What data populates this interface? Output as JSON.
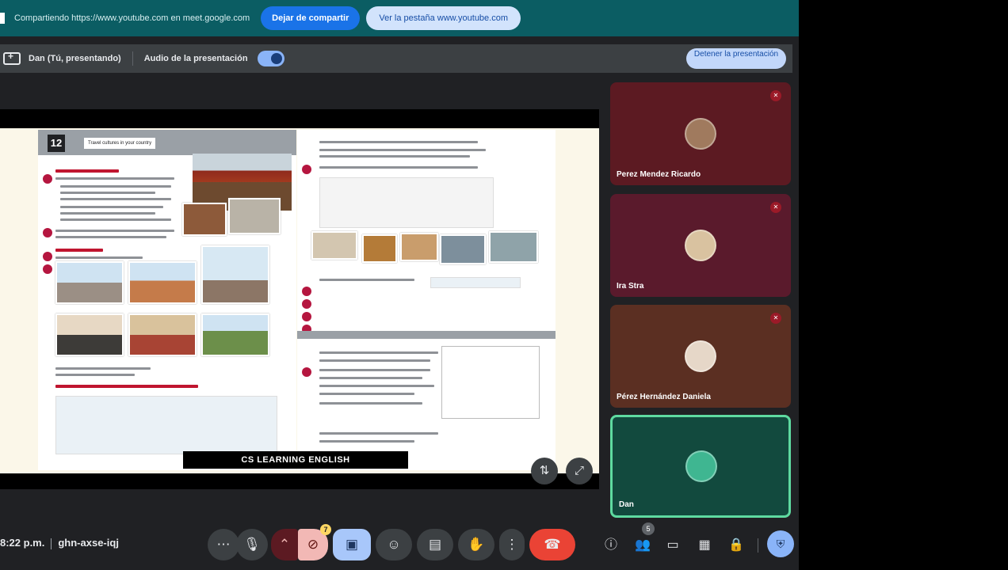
{
  "share_banner": {
    "text": "Compartiendo https://www.youtube.com en meet.google.com",
    "stop_sharing_label": "Dejar de compartir",
    "view_tab_label": "Ver la pestaña www.youtube.com"
  },
  "presenting_bar": {
    "presenter": "Dan (Tú, presentando)",
    "audio_label": "Audio de la presentación",
    "audio_enabled": true,
    "stop_presenting_label": "Detener la presentación"
  },
  "slide": {
    "unit_number": "12",
    "unit_title": "Travel cultures in your country",
    "caption": "CS LEARNING ENGLISH",
    "tools": [
      "pin-icon",
      "fullscreen-icon"
    ]
  },
  "participants": [
    {
      "name": "Perez Mendez Ricardo",
      "muted": true,
      "color": "#5c1a22"
    },
    {
      "name": "Ira Stra",
      "muted": true,
      "color": "#5a1a2c"
    },
    {
      "name": "Pérez Hernández Daniela",
      "muted": true,
      "color": "#5b2f22"
    },
    {
      "name": "Dan",
      "muted": false,
      "color": "#124a3e"
    }
  ],
  "bottom_bar": {
    "time": "8:22 p.m.",
    "meeting_code": "ghn-axse-iqj",
    "chat_badge": "7",
    "people_count": "5",
    "controls": [
      "more-options-icon",
      "mic-icon",
      "camera-chevron-icon",
      "camera-off-icon",
      "present-icon",
      "emoji-icon",
      "captions-icon",
      "raise-hand-icon",
      "more-vert-icon",
      "leave-call-icon"
    ],
    "right_controls": [
      "info-icon",
      "people-icon",
      "chat-icon",
      "activities-icon",
      "host-controls-icon"
    ]
  },
  "colors": {
    "banner_bg": "#0b5d63",
    "accent_blue": "#1a73e8",
    "leave_red": "#ea4335",
    "active_speaker_border": "#5edaa0"
  }
}
